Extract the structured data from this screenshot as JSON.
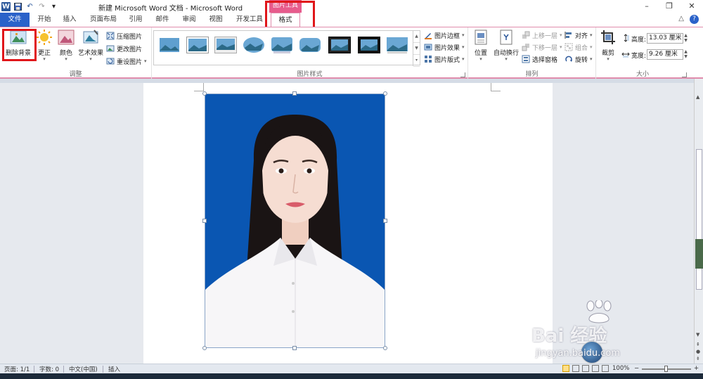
{
  "window": {
    "title": "新建 Microsoft Word 文档 - Microsoft Word",
    "context_group": "图片工具",
    "controls": {
      "minimize": "–",
      "restore": "❐",
      "close": "✕"
    }
  },
  "quick_access": {
    "logo": "W",
    "save_icon": "save-icon",
    "undo": "↶",
    "redo": "↷",
    "more": "▾"
  },
  "tabs": [
    "文件",
    "开始",
    "插入",
    "页面布局",
    "引用",
    "邮件",
    "审阅",
    "视图",
    "开发工具",
    "格式"
  ],
  "ribbon_controls": {
    "minimize": "△",
    "help": "?"
  },
  "ribbon": {
    "adjust": {
      "label": "调整",
      "remove_bg": "删除背景",
      "corrections": "更正",
      "color": "颜色",
      "artistic": "艺术效果",
      "compress": "压缩图片",
      "change": "更改图片",
      "reset": "重设图片"
    },
    "styles": {
      "label": "图片样式",
      "border": "图片边框",
      "effects": "图片效果",
      "layout": "图片版式"
    },
    "arrange": {
      "label": "排列",
      "position": "位置",
      "wrap": "自动换行",
      "forward": "上移一层",
      "backward": "下移一层",
      "pane": "选择窗格",
      "align": "对齐",
      "group": "组合",
      "rotate": "旋转"
    },
    "size": {
      "label": "大小",
      "crop": "裁剪",
      "height_label": "高度:",
      "height_value": "13.03 厘米",
      "width_label": "宽度:",
      "width_value": "9.26 厘米"
    }
  },
  "status": {
    "page": "页面: 1/1",
    "words": "字数: 0",
    "language": "中文(中国)",
    "mode": "插入",
    "zoom": "100%",
    "zoom_minus": "−",
    "zoom_plus": "+"
  },
  "watermark": {
    "brand": "Bai 经验",
    "url": "jingyan.baidu.com"
  },
  "colors": {
    "photo_bg": "#0a56b2",
    "accent": "#e75b8c",
    "highlight": "#e0161a",
    "file_tab": "#2b62c9"
  }
}
